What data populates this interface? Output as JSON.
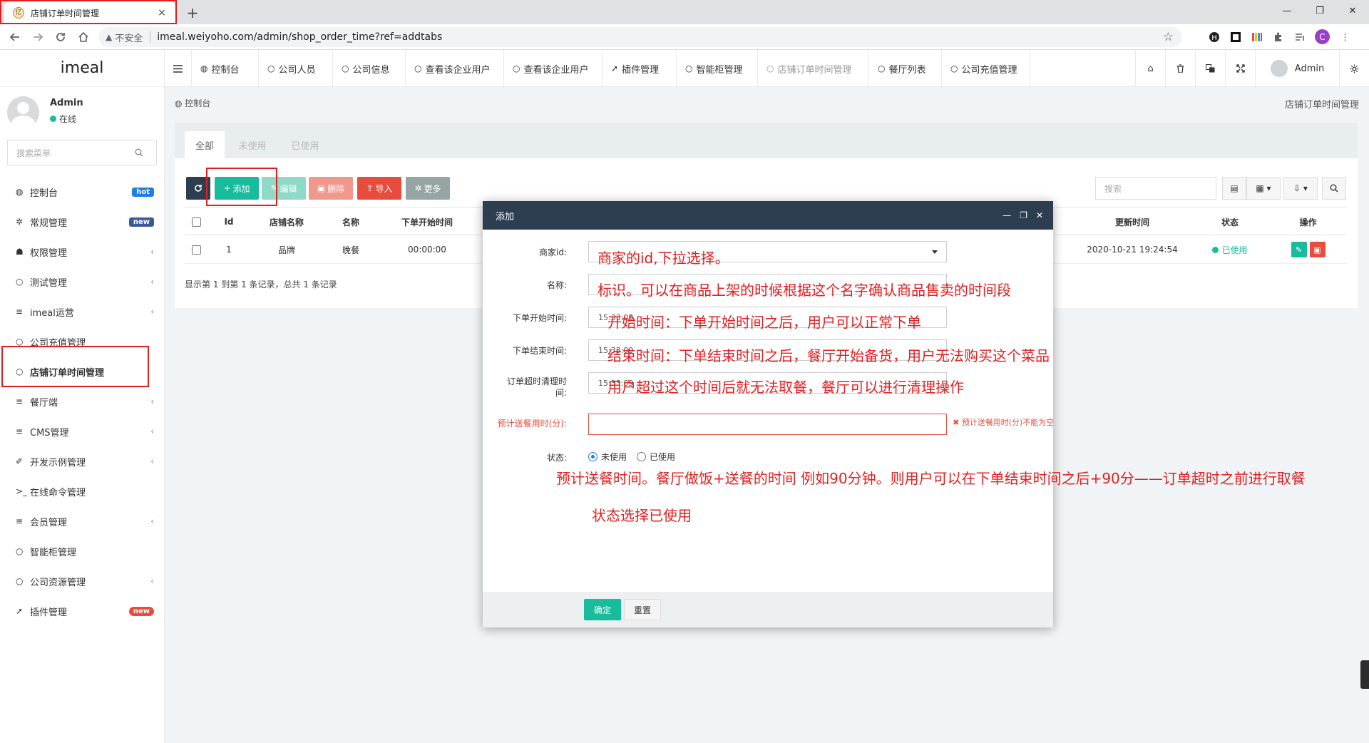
{
  "browser": {
    "tab_title": "店铺订单时间管理",
    "tab_close": "×",
    "new_tab": "+",
    "insecure_label": "不安全",
    "url": "imeal.weiyoho.com/admin/shop_order_time?ref=addtabs",
    "profile_initial": "C",
    "window_controls": [
      "—",
      "❐",
      "✕"
    ]
  },
  "sidebar": {
    "logo": "imeal",
    "user_name": "Admin",
    "user_status": "在线",
    "search_placeholder": "搜索菜单",
    "items": [
      {
        "icon": "dashboard-icon",
        "label": "控制台",
        "badge": "hot"
      },
      {
        "icon": "cogs-icon",
        "label": "常规管理",
        "badge": "new"
      },
      {
        "icon": "users-icon",
        "label": "权限管理",
        "arrow": "‹"
      },
      {
        "icon": "circle-icon",
        "label": "测试管理",
        "arrow": "‹"
      },
      {
        "icon": "list-icon",
        "label": "imeal运营",
        "arrow": "‹"
      },
      {
        "icon": "circle-icon",
        "label": "公司充值管理"
      },
      {
        "icon": "circle-icon",
        "label": "店铺订单时间管理",
        "active": true
      },
      {
        "icon": "list-icon",
        "label": "餐厅端",
        "arrow": "‹"
      },
      {
        "icon": "list-icon",
        "label": "CMS管理",
        "arrow": "‹"
      },
      {
        "icon": "magic-icon",
        "label": "开发示例管理",
        "arrow": "‹"
      },
      {
        "icon": "terminal-icon",
        "label": "在线命令管理"
      },
      {
        "icon": "list-icon",
        "label": "会员管理",
        "arrow": "‹"
      },
      {
        "icon": "circle-icon",
        "label": "智能柜管理"
      },
      {
        "icon": "circle-icon",
        "label": "公司资源管理",
        "arrow": "‹"
      },
      {
        "icon": "rocket-icon",
        "label": "插件管理",
        "badge": "new"
      }
    ]
  },
  "topnav": {
    "items": [
      "控制台",
      "公司人员",
      "公司信息",
      "查看该企业用户",
      "查看该企业用户",
      "插件管理",
      "智能柜管理",
      "店铺订单时间管理",
      "餐厅列表",
      "公司充值管理"
    ],
    "admin_label": "Admin"
  },
  "content": {
    "breadcrumb": "控制台",
    "page_title": "店铺订单时间管理",
    "tabs": [
      "全部",
      "未使用",
      "已使用"
    ],
    "buttons": {
      "add": "添加",
      "edit": "编辑",
      "delete": "删除",
      "import": "导入",
      "more": "更多"
    },
    "search_placeholder": "搜索",
    "table": {
      "headers": {
        "id": "Id",
        "shop_name": "店铺名称",
        "name": "名称",
        "start_time": "下单开始时间",
        "updated_at": "更新时间",
        "status": "状态",
        "actions": "操作"
      },
      "rows": [
        {
          "id": "1",
          "shop_name": "品牌",
          "name": "晚餐",
          "start_time": "00:00:00",
          "updated_at": "2020-10-21 19:24:54",
          "status": "已使用"
        }
      ]
    },
    "pagination": "显示第 1 到第 1 条记录，总共 1 条记录"
  },
  "modal": {
    "title": "添加",
    "fields": {
      "merchant_label": "商家id:",
      "name_label": "名称:",
      "start_label": "下单开始时间:",
      "start_value": "15:33:09",
      "end_label": "下单结束时间:",
      "end_value": "15:33:09",
      "timeout_label": "订单超时清理时间:",
      "timeout_value": "15:33:09",
      "delivery_label": "预计送餐用时(分):",
      "delivery_error": "预计送餐用时(分)不能为空",
      "status_label": "状态:",
      "status_options": [
        "未使用",
        "已使用"
      ]
    },
    "ok": "确定",
    "reset": "重置"
  },
  "annotations": {
    "merchant": "商家的id,下拉选择。",
    "name": "标识。可以在商品上架的时候根据这个名字确认商品售卖的时间段",
    "start": "开始时间：下单开始时间之后，用户可以正常下单",
    "end": "结束时间：下单结束时间之后，餐厅开始备货，用户无法购买这个菜品",
    "timeout": "用户超过这个时间后就无法取餐，餐厅可以进行清理操作",
    "delivery": "预计送餐时间。餐厅做饭+送餐的时间 例如90分钟。则用户可以在下单结束时间之后+90分——订单超时之前进行取餐",
    "status": "状态选择已使用"
  },
  "colors": {
    "primary": "#18bc9c",
    "dark": "#2c3e50",
    "danger": "#e74c3c",
    "annotation": "#e02020"
  }
}
